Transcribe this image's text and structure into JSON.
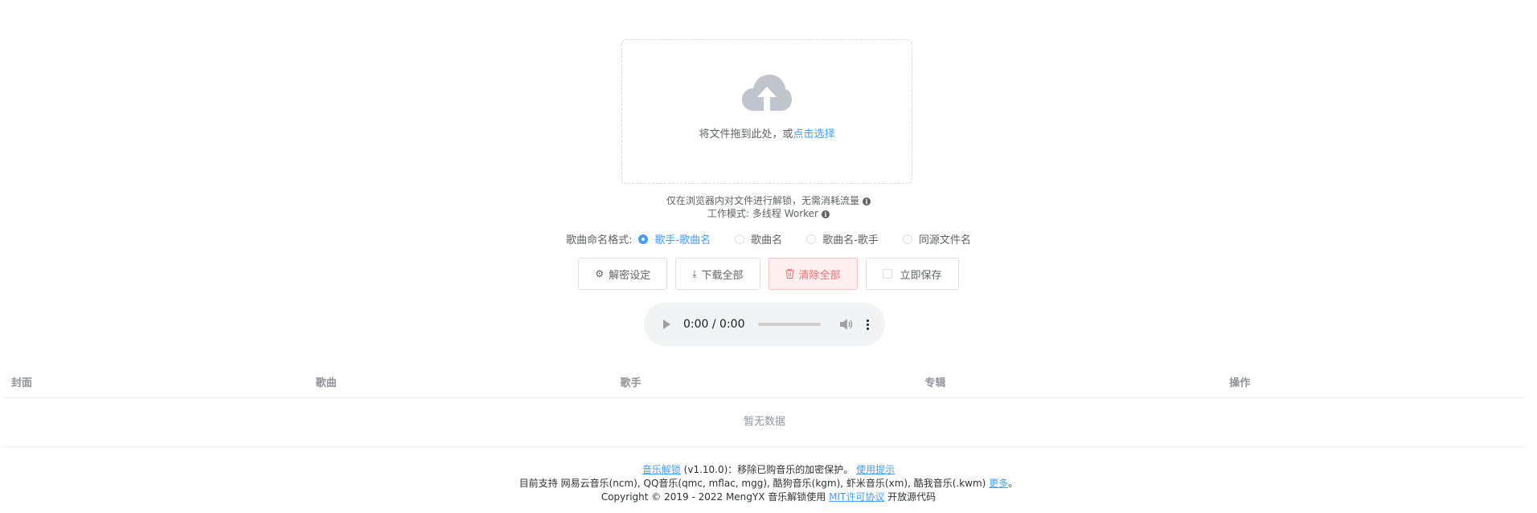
{
  "upload": {
    "text": "将文件拖到此处，或",
    "link": "点击选择",
    "icon": "cloud-upload-icon"
  },
  "tips": {
    "line1": "仅在浏览器内对文件进行解锁，无需消耗流量",
    "line2": "工作模式: 多线程 Worker",
    "info_icon_glyph": "i"
  },
  "naming": {
    "title": "歌曲命名格式:",
    "options": [
      {
        "label": "歌手-歌曲名",
        "checked": true
      },
      {
        "label": "歌曲名",
        "checked": false
      },
      {
        "label": "歌曲名-歌手",
        "checked": false
      },
      {
        "label": "同源文件名",
        "checked": false
      }
    ]
  },
  "buttons": {
    "settings": "解密设定",
    "download_all": "下载全部",
    "clear_all": "清除全部",
    "save_now": "立即保存"
  },
  "player": {
    "time": "0:00 / 0:00"
  },
  "table": {
    "headers": [
      "封面",
      "歌曲",
      "歌手",
      "专辑",
      "操作"
    ],
    "empty": "暂无数据"
  },
  "footer": {
    "line1": {
      "app_link": "音乐解锁",
      "desc": " (v1.10.0)：移除已购音乐的加密保护。 ",
      "usage_link": "使用提示"
    },
    "line2": {
      "text": "目前支持 网易云音乐(ncm), QQ音乐(qmc, mflac, mgg), 酷狗音乐(kgm), 虾米音乐(xm), 酷我音乐(.kwm) ",
      "more_link": "更多",
      "end": "。"
    },
    "line3": {
      "text": "Copyright © 2019 - 2022 MengYX 音乐解锁使用 ",
      "license_link": "MIT许可协议",
      "end": " 开放源代码"
    }
  },
  "colors": {
    "primary": "#409eff",
    "danger": "#f56c6c",
    "text": "#606266"
  }
}
